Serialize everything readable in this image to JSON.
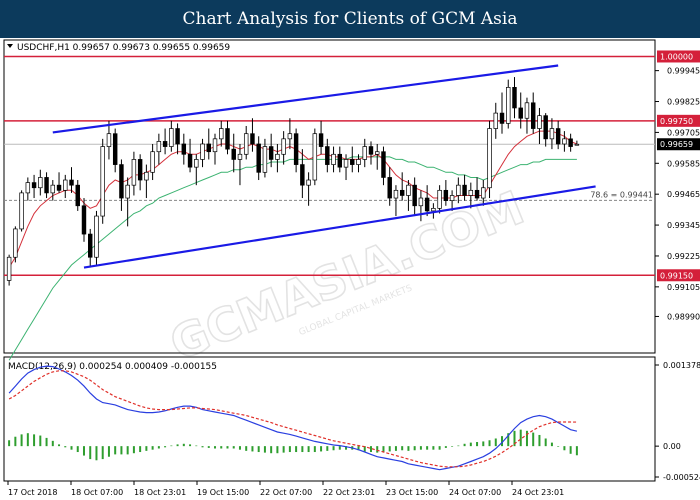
{
  "banner": {
    "title": "Chart Analysis for Clients of GCM Asia"
  },
  "watermark": {
    "text": "GCMASIA.COM",
    "subtext": "GLOBAL CAPITAL MARKETS"
  },
  "colors": {
    "banner_bg": "#0c3a5c",
    "channel": "#1a1ae6",
    "level_line": "#d4203a",
    "ma_fast": "#d4303a",
    "ma_slow": "#3cb371",
    "candle_up": "#ffffff",
    "candle_outline": "#000000",
    "macd_hist": "#2e9e2e",
    "macd_line": "#2a3fe0",
    "signal_line": "#e0302a"
  },
  "chart_data": [
    {
      "type": "candlestick",
      "title": "USDCHF,H1 0.99657 0.99673 0.99655 0.99659",
      "symbol": "USDCHF",
      "timeframe": "H1",
      "ohlc_last": {
        "open": 0.99657,
        "high": 0.99673,
        "low": 0.99655,
        "close": 0.99659
      },
      "ylim": [
        0.98848,
        1.00064
      ],
      "price_ticks": [
        "0.99945",
        "0.99825",
        "0.99705",
        "0.99585",
        "0.99465",
        "0.99345",
        "0.99225",
        "0.99105",
        "0.98990"
      ],
      "level_lines": [
        {
          "price": 1.0,
          "label": "1.00000"
        },
        {
          "price": 0.9975,
          "label": "0.99750"
        },
        {
          "price": 0.9915,
          "label": "0.99150"
        }
      ],
      "current_price": {
        "price": 0.99659,
        "label": "0.99659"
      },
      "fib_level": {
        "price": 0.99441,
        "label": "78.6 = 0.99441"
      },
      "x_ticks": [
        "17 Oct 2018",
        "18 Oct 07:00",
        "18 Oct 23:01",
        "19 Oct 15:00",
        "22 Oct 07:00",
        "22 Oct 23:01",
        "23 Oct 15:00",
        "24 Oct 07:00",
        "24 Oct 23:01"
      ],
      "channel": {
        "upper": {
          "from": [
            7,
            0.99705
          ],
          "to": [
            88,
            0.99965
          ]
        },
        "lower": {
          "from": [
            12,
            0.9918
          ],
          "to": [
            94,
            0.99495
          ]
        }
      },
      "candles": [
        [
          0.9913,
          0.9923,
          0.9911,
          0.9922
        ],
        [
          0.9922,
          0.9934,
          0.992,
          0.9933
        ],
        [
          0.9933,
          0.9948,
          0.9932,
          0.9947
        ],
        [
          0.9947,
          0.9953,
          0.9944,
          0.9951
        ],
        [
          0.9951,
          0.9954,
          0.9945,
          0.9949
        ],
        [
          0.9949,
          0.9956,
          0.9946,
          0.9953
        ],
        [
          0.9953,
          0.9955,
          0.9945,
          0.9947
        ],
        [
          0.9947,
          0.9952,
          0.9944,
          0.995
        ],
        [
          0.995,
          0.9955,
          0.9947,
          0.9948
        ],
        [
          0.9948,
          0.9954,
          0.9945,
          0.9952
        ],
        [
          0.9952,
          0.9957,
          0.9947,
          0.995
        ],
        [
          0.995,
          0.9952,
          0.994,
          0.9942
        ],
        [
          0.9942,
          0.9945,
          0.9928,
          0.9931
        ],
        [
          0.9931,
          0.9933,
          0.9918,
          0.9922
        ],
        [
          0.9922,
          0.994,
          0.9919,
          0.9938
        ],
        [
          0.9938,
          0.9968,
          0.9935,
          0.9965
        ],
        [
          0.9965,
          0.9975,
          0.996,
          0.997
        ],
        [
          0.997,
          0.9972,
          0.9955,
          0.9958
        ],
        [
          0.9958,
          0.996,
          0.994,
          0.9945
        ],
        [
          0.9945,
          0.9953,
          0.9934,
          0.995
        ],
        [
          0.995,
          0.9963,
          0.9946,
          0.996
        ],
        [
          0.996,
          0.9962,
          0.9948,
          0.9952
        ],
        [
          0.9952,
          0.9958,
          0.9945,
          0.9955
        ],
        [
          0.9955,
          0.9966,
          0.9952,
          0.9963
        ],
        [
          0.9963,
          0.997,
          0.9958,
          0.9967
        ],
        [
          0.9967,
          0.9972,
          0.9962,
          0.9965
        ],
        [
          0.9965,
          0.9975,
          0.9963,
          0.9972
        ],
        [
          0.9972,
          0.9974,
          0.9962,
          0.9966
        ],
        [
          0.9966,
          0.997,
          0.9958,
          0.9962
        ],
        [
          0.9962,
          0.9968,
          0.9955,
          0.9957
        ],
        [
          0.9957,
          0.9962,
          0.995,
          0.996
        ],
        [
          0.996,
          0.9968,
          0.9957,
          0.9966
        ],
        [
          0.9966,
          0.9972,
          0.996,
          0.9963
        ],
        [
          0.9963,
          0.997,
          0.9958,
          0.9968
        ],
        [
          0.9968,
          0.9975,
          0.9965,
          0.9972
        ],
        [
          0.9972,
          0.9975,
          0.9962,
          0.9964
        ],
        [
          0.9964,
          0.997,
          0.9955,
          0.996
        ],
        [
          0.996,
          0.9966,
          0.995,
          0.9962
        ],
        [
          0.9962,
          0.9973,
          0.996,
          0.997
        ],
        [
          0.997,
          0.9976,
          0.9963,
          0.9966
        ],
        [
          0.9966,
          0.9969,
          0.9952,
          0.9955
        ],
        [
          0.9955,
          0.9968,
          0.9953,
          0.9965
        ],
        [
          0.9965,
          0.997,
          0.9957,
          0.996
        ],
        [
          0.996,
          0.9966,
          0.9955,
          0.9962
        ],
        [
          0.9962,
          0.9971,
          0.9958,
          0.9968
        ],
        [
          0.9968,
          0.9976,
          0.9964,
          0.997
        ],
        [
          0.997,
          0.9972,
          0.9955,
          0.9958
        ],
        [
          0.9958,
          0.9964,
          0.9945,
          0.995
        ],
        [
          0.995,
          0.9955,
          0.9942,
          0.9952
        ],
        [
          0.9952,
          0.9972,
          0.995,
          0.997
        ],
        [
          0.997,
          0.9975,
          0.9962,
          0.9965
        ],
        [
          0.9965,
          0.9968,
          0.9955,
          0.9958
        ],
        [
          0.9958,
          0.9965,
          0.9955,
          0.9962
        ],
        [
          0.9962,
          0.9965,
          0.9955,
          0.9957
        ],
        [
          0.9957,
          0.9962,
          0.9952,
          0.996
        ],
        [
          0.996,
          0.9965,
          0.9955,
          0.9958
        ],
        [
          0.9958,
          0.9962,
          0.9955,
          0.996
        ],
        [
          0.996,
          0.9968,
          0.9957,
          0.9965
        ],
        [
          0.9965,
          0.9967,
          0.9958,
          0.9962
        ],
        [
          0.9962,
          0.9966,
          0.9956,
          0.9963
        ],
        [
          0.9963,
          0.9965,
          0.995,
          0.9953
        ],
        [
          0.9953,
          0.9957,
          0.9942,
          0.9945
        ],
        [
          0.9945,
          0.995,
          0.9938,
          0.9948
        ],
        [
          0.9948,
          0.9955,
          0.9944,
          0.9946
        ],
        [
          0.9946,
          0.9952,
          0.994,
          0.995
        ],
        [
          0.995,
          0.9953,
          0.9938,
          0.9942
        ],
        [
          0.9942,
          0.9948,
          0.9936,
          0.9945
        ],
        [
          0.9945,
          0.995,
          0.9938,
          0.994
        ],
        [
          0.994,
          0.9943,
          0.9937,
          0.9941
        ],
        [
          0.9941,
          0.995,
          0.9939,
          0.9948
        ],
        [
          0.9948,
          0.9952,
          0.9942,
          0.9944
        ],
        [
          0.9944,
          0.9948,
          0.994,
          0.9946
        ],
        [
          0.9946,
          0.9953,
          0.9943,
          0.995
        ],
        [
          0.995,
          0.9954,
          0.9944,
          0.9946
        ],
        [
          0.9946,
          0.9951,
          0.9941,
          0.9948
        ],
        [
          0.9948,
          0.9953,
          0.9944,
          0.9945
        ],
        [
          0.9945,
          0.9952,
          0.9942,
          0.9949
        ],
        [
          0.9949,
          0.9975,
          0.9945,
          0.9972
        ],
        [
          0.9972,
          0.9982,
          0.9968,
          0.9978
        ],
        [
          0.9978,
          0.9986,
          0.997,
          0.9974
        ],
        [
          0.9974,
          0.9991,
          0.9972,
          0.9988
        ],
        [
          0.9988,
          0.9992,
          0.9976,
          0.998
        ],
        [
          0.998,
          0.9986,
          0.9972,
          0.9976
        ],
        [
          0.9976,
          0.9984,
          0.997,
          0.9982
        ],
        [
          0.9982,
          0.9986,
          0.997,
          0.9972
        ],
        [
          0.9972,
          0.998,
          0.9966,
          0.9977
        ],
        [
          0.9977,
          0.9978,
          0.9965,
          0.9968
        ],
        [
          0.9968,
          0.9976,
          0.9964,
          0.9972
        ],
        [
          0.9972,
          0.9975,
          0.9964,
          0.9966
        ],
        [
          0.9966,
          0.9971,
          0.9963,
          0.9968
        ],
        [
          0.9968,
          0.997,
          0.9963,
          0.9965
        ],
        [
          0.99657,
          0.99673,
          0.99655,
          0.99659
        ]
      ],
      "ma_fast": [
        0.9918,
        0.9922,
        0.9928,
        0.9934,
        0.9939,
        0.9942,
        0.9944,
        0.9946,
        0.9947,
        0.9948,
        0.9948,
        0.9946,
        0.9943,
        0.9941,
        0.9942,
        0.9946,
        0.995,
        0.9952,
        0.9951,
        0.9952,
        0.9954,
        0.9954,
        0.9955,
        0.9956,
        0.9958,
        0.996,
        0.9962,
        0.9963,
        0.9963,
        0.9962,
        0.9962,
        0.9963,
        0.9964,
        0.9965,
        0.9966,
        0.9966,
        0.9965,
        0.9964,
        0.9965,
        0.9966,
        0.9965,
        0.9964,
        0.9964,
        0.9963,
        0.9964,
        0.9965,
        0.9964,
        0.9962,
        0.996,
        0.9961,
        0.9962,
        0.9962,
        0.9961,
        0.9961,
        0.996,
        0.996,
        0.996,
        0.9961,
        0.9961,
        0.9962,
        0.996,
        0.9957,
        0.9954,
        0.9952,
        0.9951,
        0.9949,
        0.9948,
        0.9947,
        0.9945,
        0.9945,
        0.9945,
        0.9945,
        0.9946,
        0.9946,
        0.9946,
        0.9946,
        0.9946,
        0.995,
        0.9954,
        0.9958,
        0.9962,
        0.9965,
        0.9967,
        0.9969,
        0.997,
        0.9971,
        0.9971,
        0.9971,
        0.997,
        0.9969,
        0.9967,
        0.9966
      ],
      "ma_slow": [
        0.9882,
        0.9886,
        0.989,
        0.9894,
        0.9898,
        0.9902,
        0.9906,
        0.991,
        0.9913,
        0.9916,
        0.9919,
        0.9921,
        0.9923,
        0.9925,
        0.9927,
        0.9929,
        0.9931,
        0.9933,
        0.9935,
        0.9937,
        0.9939,
        0.994,
        0.9942,
        0.9943,
        0.9945,
        0.9946,
        0.9947,
        0.9948,
        0.9949,
        0.995,
        0.9951,
        0.9952,
        0.9953,
        0.9954,
        0.9955,
        0.9955,
        0.9956,
        0.9956,
        0.9957,
        0.9957,
        0.9958,
        0.9958,
        0.9959,
        0.9959,
        0.9959,
        0.996,
        0.996,
        0.996,
        0.996,
        0.996,
        0.996,
        0.996,
        0.996,
        0.996,
        0.996,
        0.9961,
        0.9961,
        0.9961,
        0.9961,
        0.9961,
        0.9961,
        0.9961,
        0.996,
        0.996,
        0.9959,
        0.9959,
        0.9958,
        0.9957,
        0.9957,
        0.9956,
        0.9955,
        0.9955,
        0.9954,
        0.9954,
        0.9953,
        0.9953,
        0.9952,
        0.9953,
        0.9954,
        0.9955,
        0.9956,
        0.9957,
        0.9958,
        0.9958,
        0.9959,
        0.9959,
        0.996,
        0.996,
        0.996,
        0.996,
        0.996,
        0.996
      ]
    },
    {
      "type": "macd",
      "title": "MACD(12,26,9) 0.000254 0.000409 -0.000155",
      "params": [
        12,
        26,
        9
      ],
      "values_last": {
        "macd": 0.000254,
        "signal": 0.000409,
        "histogram": -0.000155
      },
      "ylim": [
        -0.000524,
        0.001378
      ],
      "y_ticks": [
        "0.001378",
        "0.00",
        "-0.000524"
      ],
      "x_ticks": [
        "17 Oct 2018",
        "18 Oct 07:00",
        "18 Oct 23:01",
        "19 Oct 15:00",
        "22 Oct 07:00",
        "22 Oct 23:01",
        "23 Oct 15:00",
        "24 Oct 07:00",
        "24 Oct 23:01"
      ],
      "macd": [
        0.0009,
        0.00102,
        0.00114,
        0.00124,
        0.0013,
        0.00134,
        0.00136,
        0.00135,
        0.00131,
        0.00126,
        0.0012,
        0.00112,
        0.00102,
        0.0009,
        0.0008,
        0.00074,
        0.00072,
        0.0007,
        0.00066,
        0.00062,
        0.0006,
        0.00058,
        0.00057,
        0.00057,
        0.00058,
        0.0006,
        0.00063,
        0.00066,
        0.00068,
        0.00068,
        0.00066,
        0.00062,
        0.0006,
        0.00058,
        0.00056,
        0.00054,
        0.00052,
        0.00048,
        0.00044,
        0.0004,
        0.00036,
        0.00032,
        0.00028,
        0.00024,
        0.00022,
        0.0002,
        0.00017,
        0.00014,
        0.00011,
        8e-05,
        6e-05,
        4e-05,
        2e-05,
        1e-05,
        -1e-05,
        -3e-05,
        -6e-05,
        -0.0001,
        -0.00014,
        -0.00018,
        -0.0002,
        -0.00022,
        -0.00024,
        -0.00026,
        -0.0003,
        -0.00032,
        -0.00034,
        -0.00036,
        -0.00038,
        -0.0004,
        -0.00038,
        -0.00036,
        -0.00034,
        -0.0003,
        -0.00026,
        -0.00022,
        -0.00018,
        -0.00012,
        -4e-05,
        6e-05,
        0.00018,
        0.0003,
        0.0004,
        0.00046,
        0.0005,
        0.00052,
        0.0005,
        0.00046,
        0.0004,
        0.00034,
        0.00028,
        0.000254
      ],
      "signal": [
        0.0008,
        0.00086,
        0.00094,
        0.00102,
        0.0011,
        0.00116,
        0.00122,
        0.00126,
        0.00128,
        0.00128,
        0.00126,
        0.00122,
        0.00118,
        0.00112,
        0.00104,
        0.00096,
        0.0009,
        0.00084,
        0.0008,
        0.00076,
        0.00072,
        0.00068,
        0.00065,
        0.00063,
        0.00062,
        0.00062,
        0.00062,
        0.00063,
        0.00064,
        0.00065,
        0.00065,
        0.00064,
        0.00063,
        0.00062,
        0.0006,
        0.00058,
        0.00056,
        0.00054,
        0.00052,
        0.00049,
        0.00046,
        0.00043,
        0.0004,
        0.00036,
        0.00033,
        0.0003,
        0.00027,
        0.00024,
        0.00021,
        0.00018,
        0.00015,
        0.00012,
        9e-05,
        7e-05,
        5e-05,
        3e-05,
        1e-05,
        -1e-05,
        -4e-05,
        -7e-05,
        -0.0001,
        -0.00013,
        -0.00016,
        -0.00019,
        -0.00022,
        -0.00025,
        -0.00028,
        -0.0003,
        -0.00032,
        -0.00034,
        -0.00035,
        -0.00035,
        -0.00035,
        -0.00034,
        -0.00032,
        -0.00029,
        -0.00026,
        -0.00022,
        -0.00017,
        -0.00011,
        -4e-05,
        4e-05,
        0.00012,
        0.0002,
        0.00027,
        0.00033,
        0.00037,
        0.0004,
        0.00041,
        0.00041,
        0.00041,
        0.000409
      ]
    }
  ]
}
